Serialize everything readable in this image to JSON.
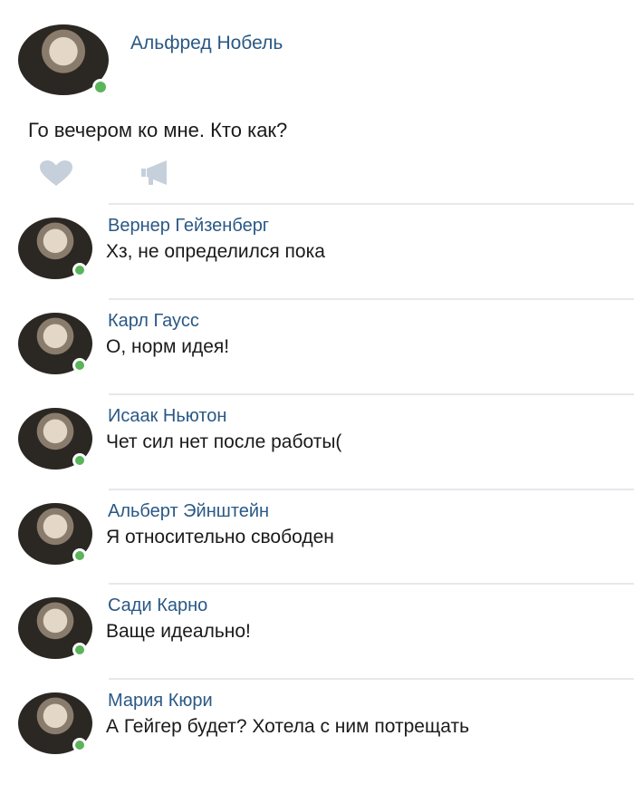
{
  "post": {
    "author": "Альфред Нобель",
    "text": "Го вечером ко мне. Кто как?",
    "avatar_icon": "portrait-photo",
    "like_icon": "heart-icon",
    "share_icon": "megaphone-icon",
    "online": true
  },
  "comments": [
    {
      "author": "Вернер Гейзенберг",
      "text": "Хз, не определился пока",
      "online": true
    },
    {
      "author": "Карл Гаусс",
      "text": "О, норм идея!",
      "online": true
    },
    {
      "author": "Исаак Ньютон",
      "text": "Чет сил нет после работы(",
      "online": true
    },
    {
      "author": "Альберт Эйнштейн",
      "text": "Я относительно свободен",
      "online": true
    },
    {
      "author": "Сади Карно",
      "text": "Ваще идеально!",
      "online": true
    },
    {
      "author": "Мария Кюри",
      "text": "А Гейгер будет? Хотела с ним потрещать",
      "online": true
    }
  ],
  "colors": {
    "link": "#2a5885",
    "online": "#5ab45a",
    "icon": "#c5d0db",
    "divider": "#e7e8ec"
  }
}
